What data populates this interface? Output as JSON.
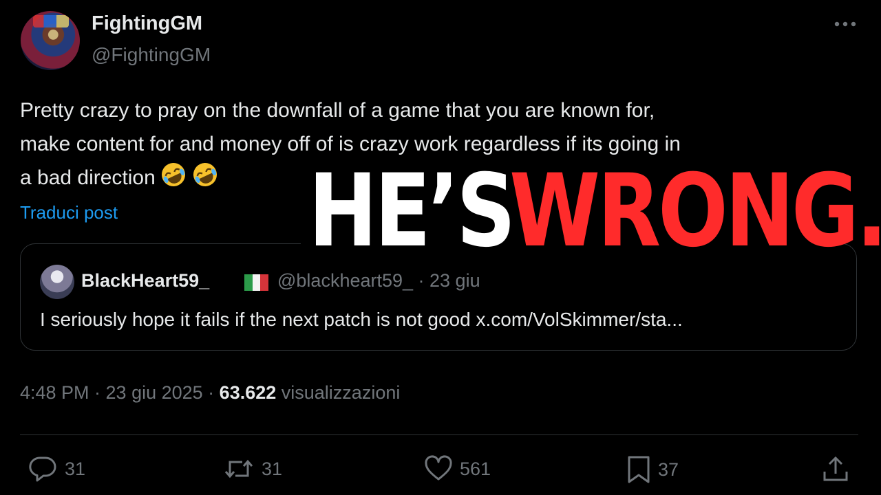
{
  "author": {
    "name": "FightingGM",
    "handle": "@FightingGM"
  },
  "post": {
    "text_line1": "Pretty crazy to pray on the downfall  of a game that you are known for,",
    "text_line2": "make content for and money off of is crazy work regardless if its going in",
    "text_line3": "a bad direction",
    "emojis": [
      "rolling-on-floor-laughing",
      "rolling-on-floor-laughing"
    ],
    "translate_label": "Traduci post"
  },
  "quote": {
    "name": "BlackHeart59_",
    "flag": "italy",
    "handle_date": "@blackheart59_ · 23 giu",
    "text": "I seriously hope it fails if the next patch is not good x.com/VolSkimmer/sta..."
  },
  "meta": {
    "time_date": "4:48 PM · 23 giu 2025 · ",
    "views_count": "63.622",
    "views_label": "visualizzazioni"
  },
  "actions": {
    "replies": "31",
    "reposts": "31",
    "likes": "561",
    "bookmarks": "37"
  },
  "overlay": {
    "white_text": "HE’S",
    "red_text": "WRONG."
  },
  "colors": {
    "background": "#000000",
    "accent_link": "#1d9bf0",
    "overlay_red": "#ff2b2b",
    "muted": "#71767b"
  }
}
